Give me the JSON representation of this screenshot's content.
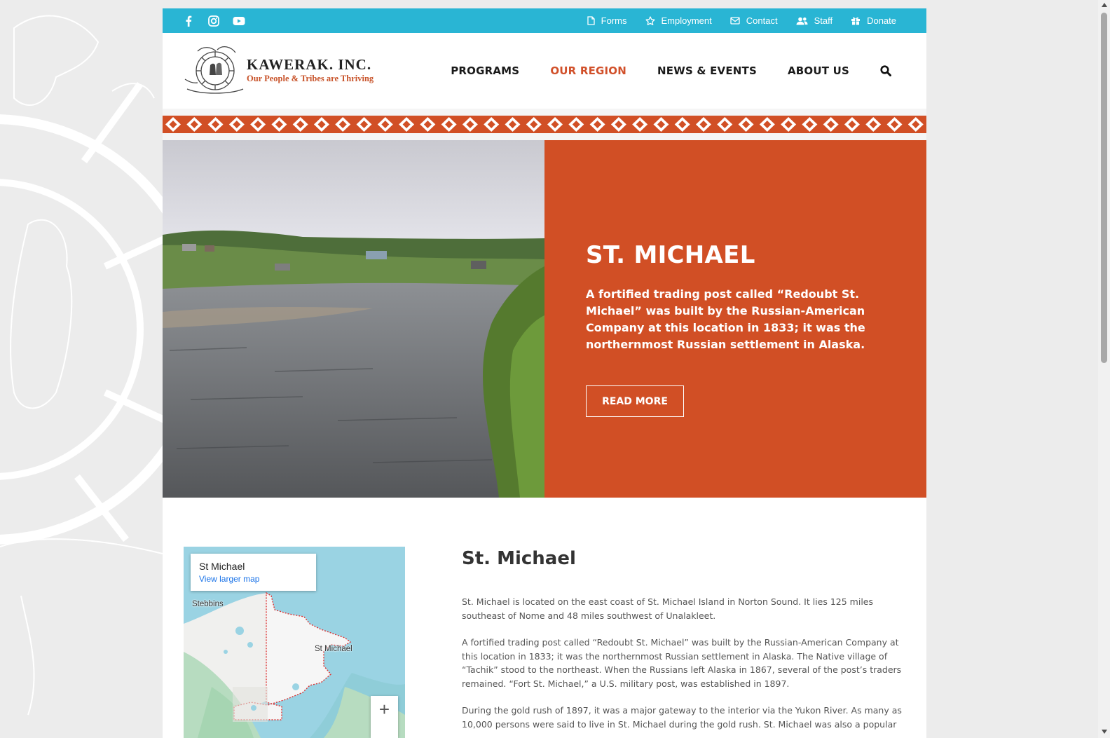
{
  "topbar": {
    "social": [
      "facebook-icon",
      "instagram-icon",
      "youtube-icon"
    ],
    "links": [
      {
        "icon": "file-icon",
        "label": "Forms"
      },
      {
        "icon": "star-icon",
        "label": "Employment"
      },
      {
        "icon": "mail-icon",
        "label": "Contact"
      },
      {
        "icon": "users-icon",
        "label": "Staff"
      },
      {
        "icon": "gift-icon",
        "label": "Donate"
      }
    ],
    "color": "#29b5d4"
  },
  "logo": {
    "title": "KAWERAK. INC.",
    "subtitle": "Our People & Tribes are Thriving"
  },
  "nav": {
    "items": [
      "PROGRAMS",
      "OUR REGION",
      "NEWS & EVENTS",
      "ABOUT US"
    ],
    "active": "OUR REGION",
    "search_icon": "search-icon"
  },
  "hero": {
    "title": "ST. MICHAEL",
    "text": "A fortified trading post called “Redoubt St. Michael” was built by the Russian-American Company at this location in 1833; it was the northernmost Russian settlement in Alaska.",
    "button": "READ MORE",
    "panel_color": "#d14f25"
  },
  "map": {
    "card_title": "St Michael",
    "card_link": "View larger map",
    "labels": [
      "Stebbins",
      "St Michael"
    ],
    "zoom_in": "+"
  },
  "article": {
    "title": "St. Michael",
    "paragraphs": [
      "St. Michael is located on the east coast of St. Michael Island in Norton Sound. It lies 125 miles southeast of Nome and 48 miles southwest of Unalakleet.",
      "A fortified trading post called “Redoubt St. Michael” was built by the Russian-American Company at this location in 1833; it was the northernmost Russian settlement in Alaska. The Native village of “Tachik” stood to the northeast. When the Russians left Alaska in 1867, several of the post’s traders remained. “Fort St. Michael,” a U.S. military post, was established in 1897.",
      "During the gold rush of 1897, it was a major gateway to the interior via the Yukon River. As many as 10,000 persons were said to live in St. Michael during the gold rush. St. Michael was also a popular"
    ]
  }
}
